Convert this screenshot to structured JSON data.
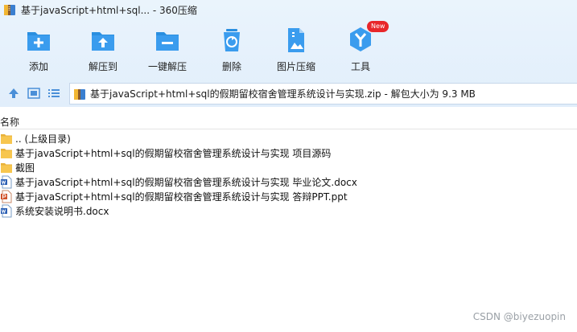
{
  "window": {
    "title": "基于javaScript+html+sql... - 360压缩"
  },
  "toolbar": {
    "items": [
      {
        "label": "添加",
        "icon": "add-icon"
      },
      {
        "label": "解压到",
        "icon": "extract-to-icon"
      },
      {
        "label": "一键解压",
        "icon": "one-click-extract-icon"
      },
      {
        "label": "删除",
        "icon": "delete-icon"
      },
      {
        "label": "图片压缩",
        "icon": "image-compress-icon"
      },
      {
        "label": "工具",
        "icon": "tools-icon",
        "badge": "New"
      }
    ]
  },
  "address": {
    "path": "基于javaScript+html+sql的假期留校宿舍管理系统设计与实现.zip - 解包大小为 9.3 MB"
  },
  "list": {
    "column_name": "名称",
    "files": [
      {
        "name": ".. (上级目录)",
        "type": "folder"
      },
      {
        "name": "基于javaScript+html+sql的假期留校宿舍管理系统设计与实现 项目源码",
        "type": "folder"
      },
      {
        "name": "截图",
        "type": "folder"
      },
      {
        "name": "基于javaScript+html+sql的假期留校宿舍管理系统设计与实现 毕业论文.docx",
        "type": "docx"
      },
      {
        "name": "基于javaScript+html+sql的假期留校宿舍管理系统设计与实现 答辩PPT.ppt",
        "type": "ppt"
      },
      {
        "name": "系统安装说明书.docx",
        "type": "docx"
      }
    ]
  },
  "watermark": "CSDN @biyezuopin",
  "colors": {
    "toolbar_bg": "#e1eefb",
    "icon_blue": "#2a8fe0",
    "badge_red": "#e8262a",
    "folder_yellow": "#f7c64f"
  }
}
